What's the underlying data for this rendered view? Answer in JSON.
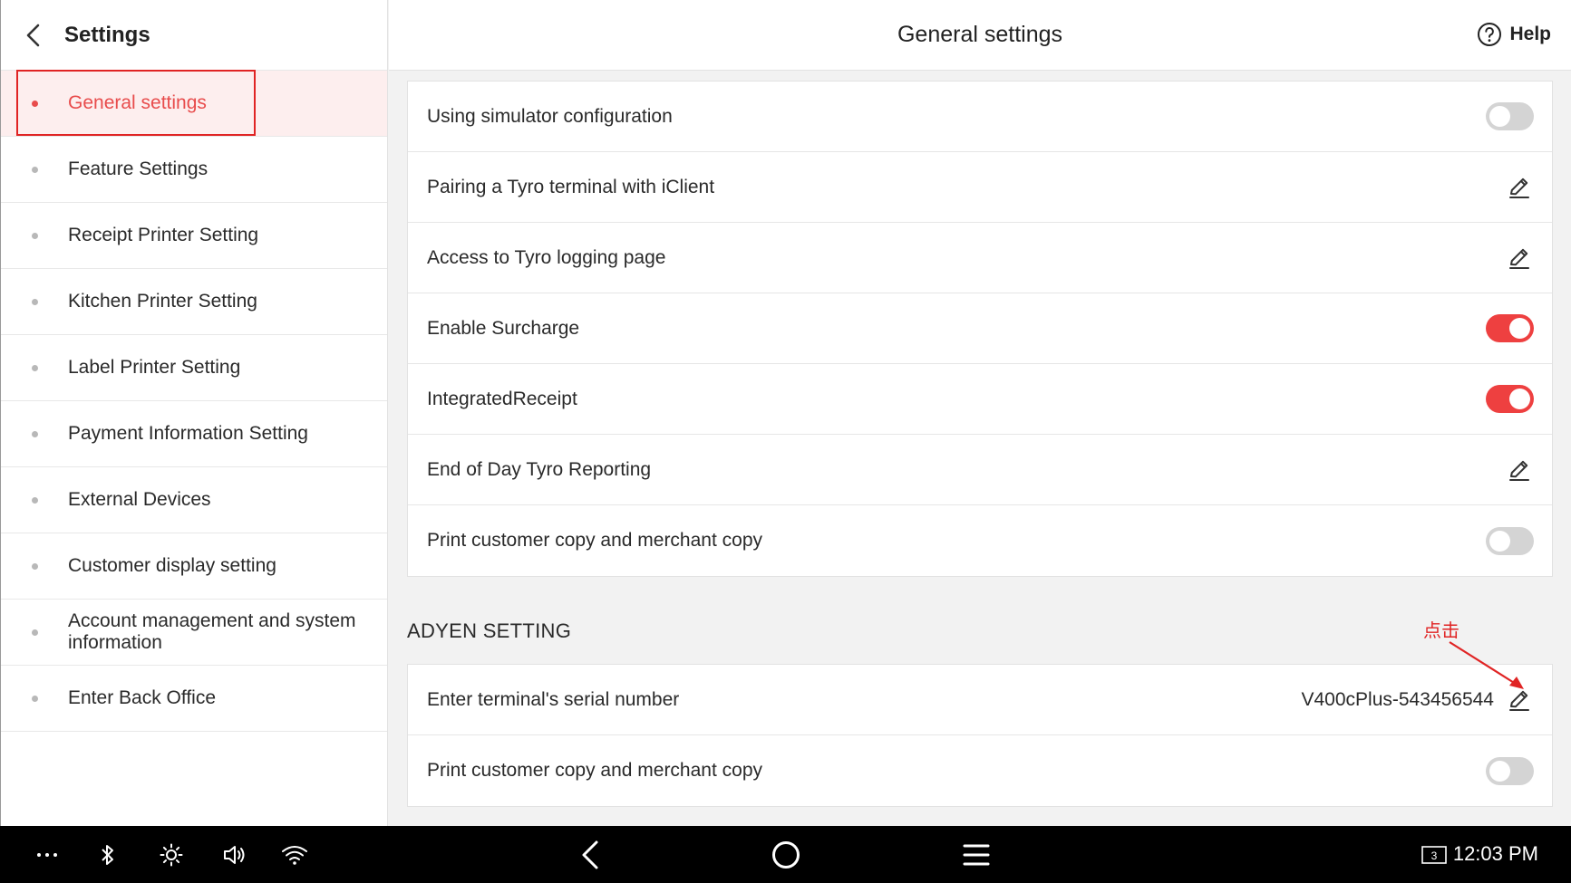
{
  "sidebar": {
    "title": "Settings",
    "items": [
      {
        "label": "General settings"
      },
      {
        "label": "Feature Settings"
      },
      {
        "label": "Receipt Printer Setting"
      },
      {
        "label": "Kitchen Printer Setting"
      },
      {
        "label": "Label Printer Setting"
      },
      {
        "label": "Payment Information Setting"
      },
      {
        "label": "External Devices"
      },
      {
        "label": "Customer display setting"
      },
      {
        "label": "Account management and system information"
      },
      {
        "label": "Enter Back Office"
      }
    ]
  },
  "header": {
    "title": "General settings",
    "help_label": "Help"
  },
  "tyro_rows": [
    {
      "label": "Using simulator configuration",
      "control": "toggle",
      "on": false
    },
    {
      "label": "Pairing a Tyro terminal with iClient",
      "control": "edit"
    },
    {
      "label": "Access to Tyro logging page",
      "control": "edit"
    },
    {
      "label": "Enable Surcharge",
      "control": "toggle",
      "on": true
    },
    {
      "label": "IntegratedReceipt",
      "control": "toggle",
      "on": true
    },
    {
      "label": "End of Day Tyro Reporting",
      "control": "edit"
    },
    {
      "label": "Print customer copy and merchant copy",
      "control": "toggle",
      "on": false
    }
  ],
  "adyen": {
    "section_title": "ADYEN SETTING",
    "annotation": "点击",
    "rows": [
      {
        "label": "Enter terminal's serial number",
        "value": "V400cPlus-543456544",
        "control": "edit"
      },
      {
        "label": "Print customer copy and merchant copy",
        "control": "toggle",
        "on": false
      }
    ]
  },
  "statusbar": {
    "time": "12:03 PM",
    "screen_badge": "3"
  },
  "colors": {
    "accent": "#ee4040",
    "annotation": "#e02424"
  }
}
